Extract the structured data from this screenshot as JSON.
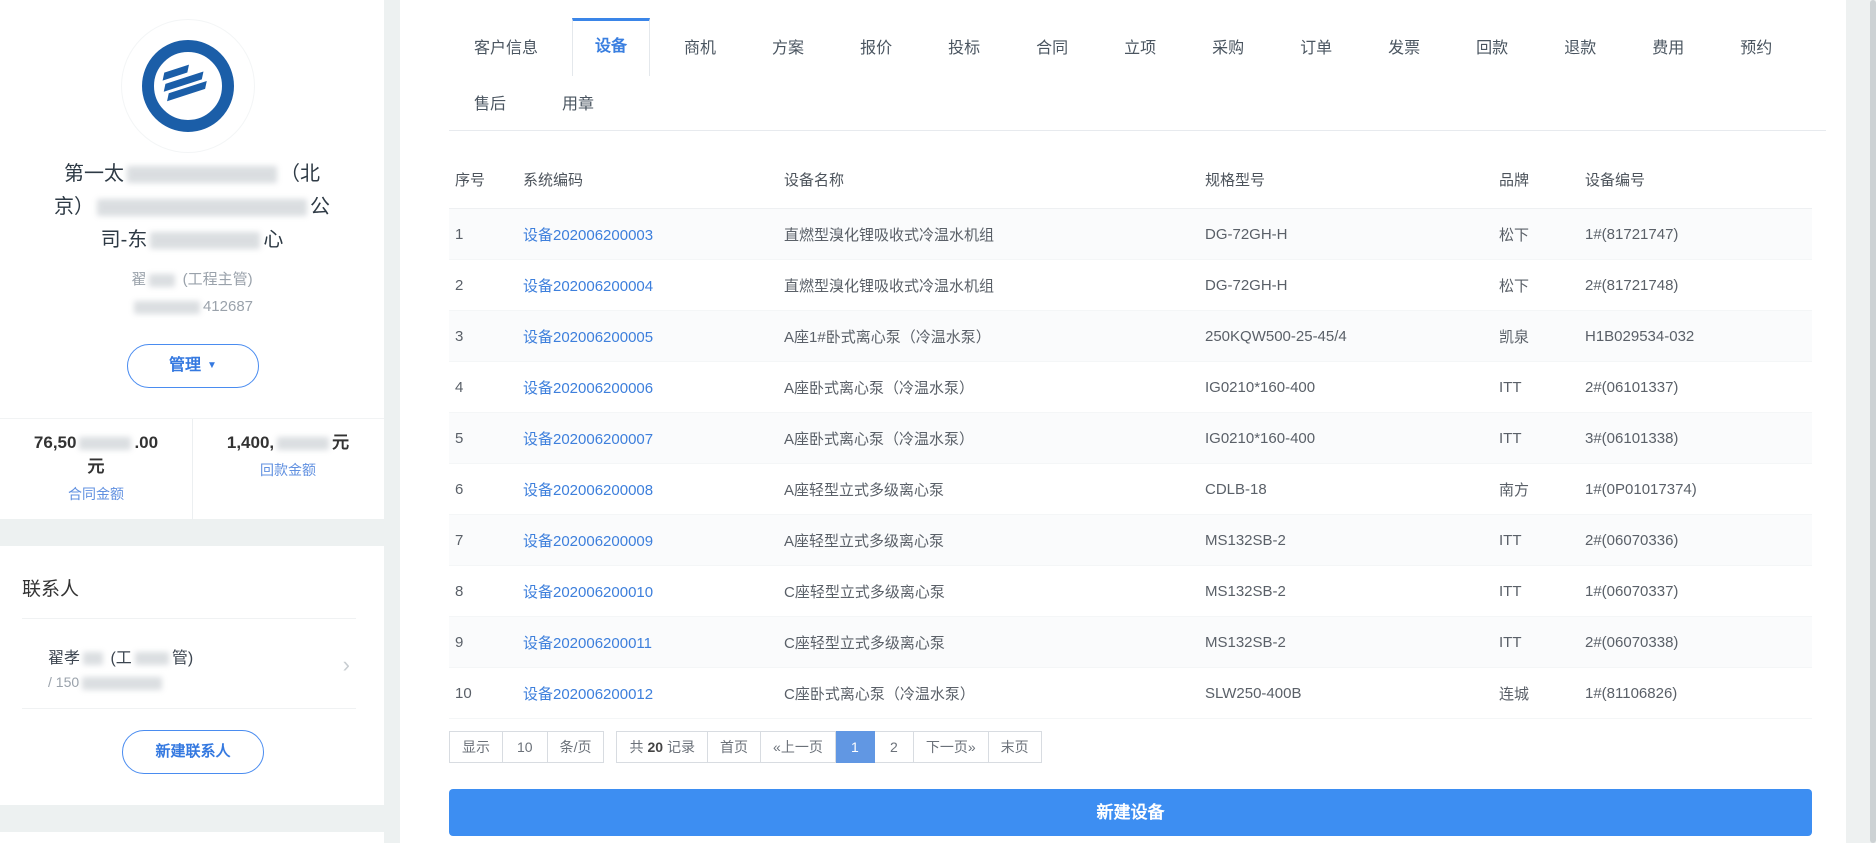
{
  "sidebar": {
    "company_line1_a": "第一太",
    "company_line1_b": "（北",
    "company_line2_a": "京）",
    "company_line2_b": "公",
    "company_line3_a": "司-东",
    "company_line3_b": "心",
    "owner_name": "翟",
    "owner_title": "(工程主管)",
    "owner_phone_tail": "412687",
    "manage_label": "管理",
    "contract_value_prefix": "76,50",
    "contract_value_suffix": ".00",
    "contract_unit": "元",
    "contract_label": "合同金额",
    "payment_value_prefix": "1,400,",
    "payment_unit": "元",
    "payment_label": "回款金额",
    "contacts_title": "联系人",
    "contact_name_a": "翟孝",
    "contact_name_b": "(工",
    "contact_name_c": "管)",
    "contact_phone": "/ 150",
    "new_contact_label": "新建联系人"
  },
  "tabs": {
    "row1": [
      "客户信息",
      "设备",
      "商机",
      "方案",
      "报价",
      "投标",
      "合同",
      "立项",
      "采购",
      "订单",
      "发票",
      "回款",
      "退款",
      "费用",
      "预约"
    ],
    "row2": [
      "售后",
      "用章"
    ],
    "active": "设备"
  },
  "table": {
    "headers": [
      "序号",
      "系统编码",
      "设备名称",
      "规格型号",
      "品牌",
      "设备编号"
    ],
    "rows": [
      {
        "idx": "1",
        "code": "设备202006200003",
        "name": "直燃型溴化锂吸收式冷温水机组",
        "spec": "DG-72GH-H",
        "brand": "松下",
        "devno": "1#(81721747)"
      },
      {
        "idx": "2",
        "code": "设备202006200004",
        "name": "直燃型溴化锂吸收式冷温水机组",
        "spec": "DG-72GH-H",
        "brand": "松下",
        "devno": "2#(81721748)"
      },
      {
        "idx": "3",
        "code": "设备202006200005",
        "name": "A座1#卧式离心泵（冷温水泵）",
        "spec": "250KQW500-25-45/4",
        "brand": "凯泉",
        "devno": "H1B029534-032"
      },
      {
        "idx": "4",
        "code": "设备202006200006",
        "name": "A座卧式离心泵（冷温水泵）",
        "spec": "IG0210*160-400",
        "brand": "ITT",
        "devno": "2#(06101337)"
      },
      {
        "idx": "5",
        "code": "设备202006200007",
        "name": "A座卧式离心泵（冷温水泵）",
        "spec": "IG0210*160-400",
        "brand": "ITT",
        "devno": "3#(06101338)"
      },
      {
        "idx": "6",
        "code": "设备202006200008",
        "name": "A座轻型立式多级离心泵",
        "spec": "CDLB-18",
        "brand": "南方",
        "devno": "1#(0P01017374)"
      },
      {
        "idx": "7",
        "code": "设备202006200009",
        "name": "A座轻型立式多级离心泵",
        "spec": "MS132SB-2",
        "brand": "ITT",
        "devno": "2#(06070336)"
      },
      {
        "idx": "8",
        "code": "设备202006200010",
        "name": "C座轻型立式多级离心泵",
        "spec": "MS132SB-2",
        "brand": "ITT",
        "devno": "1#(06070337)"
      },
      {
        "idx": "9",
        "code": "设备202006200011",
        "name": "C座轻型立式多级离心泵",
        "spec": "MS132SB-2",
        "brand": "ITT",
        "devno": "2#(06070338)"
      },
      {
        "idx": "10",
        "code": "设备202006200012",
        "name": "C座卧式离心泵（冷温水泵）",
        "spec": "SLW250-400B",
        "brand": "连城",
        "devno": "1#(81106826)"
      }
    ]
  },
  "pagination": {
    "show_label": "显示",
    "page_size": "10",
    "per_page_label": "条/页",
    "total_prefix": "共",
    "total_count": "20",
    "total_suffix": "记录",
    "first": "首页",
    "prev": "«上一页",
    "page1": "1",
    "page2": "2",
    "next": "下一页»",
    "last": "末页"
  },
  "footer_button_label": "新建设备",
  "colors": {
    "accent_blue": "#3d8ef2",
    "link_blue": "#3d7fdc",
    "pager_active_blue": "#6197e3"
  }
}
